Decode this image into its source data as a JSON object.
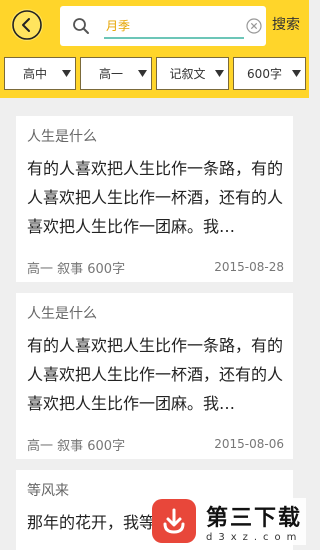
{
  "header": {
    "search_placeholder": "月季",
    "search_button": "搜索"
  },
  "filters": [
    {
      "label": "高中"
    },
    {
      "label": "高一"
    },
    {
      "label": "记叙文"
    },
    {
      "label": "600字"
    }
  ],
  "articles": [
    {
      "title": "人生是什么",
      "summary": "有的人喜欢把人生比作一条路，有的人喜欢把人生比作一杯酒，还有的人喜欢把人生比作一团麻。我…",
      "meta": "高一 叙事 600字",
      "date": "2015-08-28"
    },
    {
      "title": "人生是什么",
      "summary": "有的人喜欢把人生比作一条路，有的人喜欢把人生比作一杯酒，还有的人喜欢把人生比作一团麻。我…",
      "meta": "高一 叙事 600字",
      "date": "2015-08-06"
    },
    {
      "title": "等风来",
      "summary": "那年的花开，我等"
    }
  ],
  "watermark": {
    "cn": "第三下载",
    "en": "d3xz.com"
  },
  "colors": {
    "accent": "#ffd52a",
    "input_underline": "#6cc6b8",
    "logo_red": "#e8473a"
  }
}
